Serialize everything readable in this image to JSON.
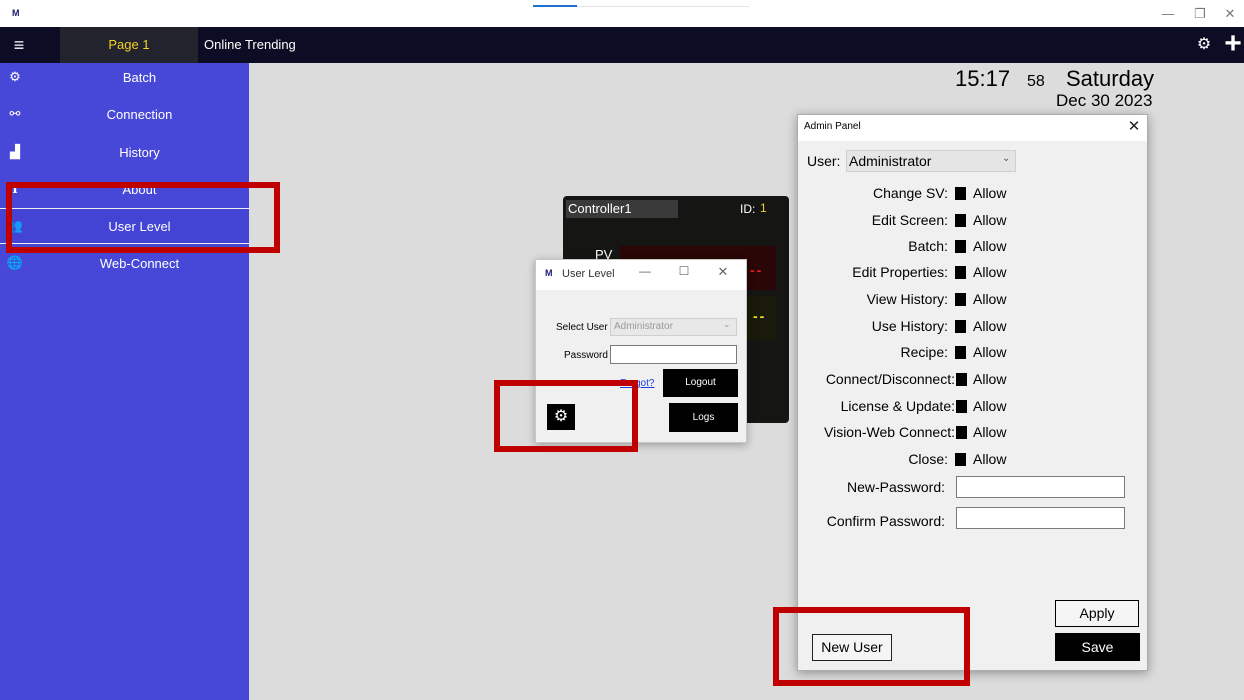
{
  "titlebar": {
    "app_logo": "M",
    "minimize_glyph": "—",
    "restore_glyph": "❐",
    "close_glyph": "✕"
  },
  "topnav": {
    "tabs": [
      {
        "label": "Page 1",
        "active": true
      },
      {
        "label": "Online Trending",
        "active": false
      }
    ],
    "menu_icon": "hamburger-icon",
    "settings_icon": "gear-icon",
    "add_icon": "plus-icon"
  },
  "sidebar": {
    "items": [
      {
        "label": "Batch",
        "icon": "gears-icon"
      },
      {
        "label": "Connection",
        "icon": "connection-icon"
      },
      {
        "label": "History",
        "icon": "chart-icon"
      },
      {
        "label": "About",
        "icon": "info-icon"
      },
      {
        "label": "User Level",
        "icon": "users-icon",
        "selected": true
      },
      {
        "label": "Web-Connect",
        "icon": "globe-icon"
      }
    ]
  },
  "clock": {
    "time": "15:17",
    "seconds": "58",
    "day": "Saturday",
    "date": "Dec 30 2023"
  },
  "controller": {
    "name": "Controller1",
    "id_label": "ID:",
    "id_value": "1",
    "pv_label": "PV",
    "pv_value": "--",
    "sv_value": "--"
  },
  "user_level_window": {
    "title": "User Level",
    "select_user_label": "Select User",
    "select_user_value": "Administrator",
    "password_label": "Password",
    "forgot_link": "Forgot?",
    "logout_button": "Logout",
    "logs_button": "Logs"
  },
  "admin_panel": {
    "title": "Admin Panel",
    "user_label": "User:",
    "user_value": "Administrator",
    "permissions": [
      {
        "label": "Change SV:",
        "value": "Allow"
      },
      {
        "label": "Edit Screen:",
        "value": "Allow"
      },
      {
        "label": "Batch:",
        "value": "Allow"
      },
      {
        "label": "Edit Properties:",
        "value": "Allow"
      },
      {
        "label": "View History:",
        "value": "Allow"
      },
      {
        "label": "Use History:",
        "value": "Allow"
      },
      {
        "label": "Recipe:",
        "value": "Allow"
      },
      {
        "label": "Connect/Disconnect:",
        "value": "Allow"
      },
      {
        "label": "License & Update:",
        "value": "Allow"
      },
      {
        "label": "Vision-Web Connect:",
        "value": "Allow"
      },
      {
        "label": "Close:",
        "value": "Allow"
      }
    ],
    "new_password_label": "New-Password:",
    "confirm_password_label": "Confirm Password:",
    "apply_button": "Apply",
    "save_button": "Save",
    "new_user_button": "New User"
  },
  "colors": {
    "sidebar_bg": "#4848d8",
    "topnav_bg": "#0c0c24",
    "active_tab_text": "#f2d024",
    "highlight_red": "#c00000",
    "pv_red": "#ee1c1c",
    "sv_yellow": "#f2e81c"
  }
}
